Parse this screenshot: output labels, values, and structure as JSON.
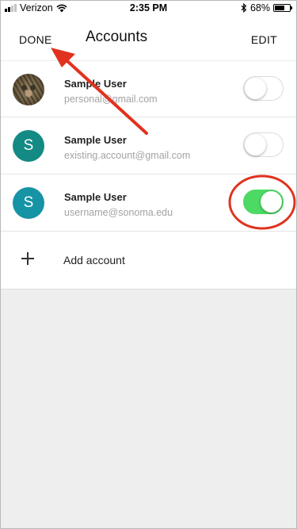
{
  "status_bar": {
    "carrier": "Verizon",
    "time": "2:35 PM",
    "battery_percent": "68%",
    "battery_level": 0.68,
    "signal_bars": 2,
    "icons": [
      "signal-bars",
      "wifi",
      "bluetooth",
      "battery"
    ]
  },
  "header": {
    "done_label": "DONE",
    "title": "Accounts",
    "edit_label": "EDIT"
  },
  "accounts": [
    {
      "name": "Sample User",
      "email": "personal@gmail.com",
      "avatar": "photo",
      "avatar_color": "#6f5f44",
      "enabled": false
    },
    {
      "name": "Sample User",
      "email": "existing.account@gmail.com",
      "avatar": "S",
      "avatar_color": "#138a84",
      "enabled": false
    },
    {
      "name": "Sample User",
      "email": "username@sonoma.edu",
      "avatar": "S",
      "avatar_color": "#1793a6",
      "enabled": true
    }
  ],
  "add_account": {
    "label": "Add account",
    "icon": "plus-icon"
  },
  "colors": {
    "toggle_on": "#4cd964",
    "annotation": "#e0321e",
    "background": "#eeeeee"
  }
}
